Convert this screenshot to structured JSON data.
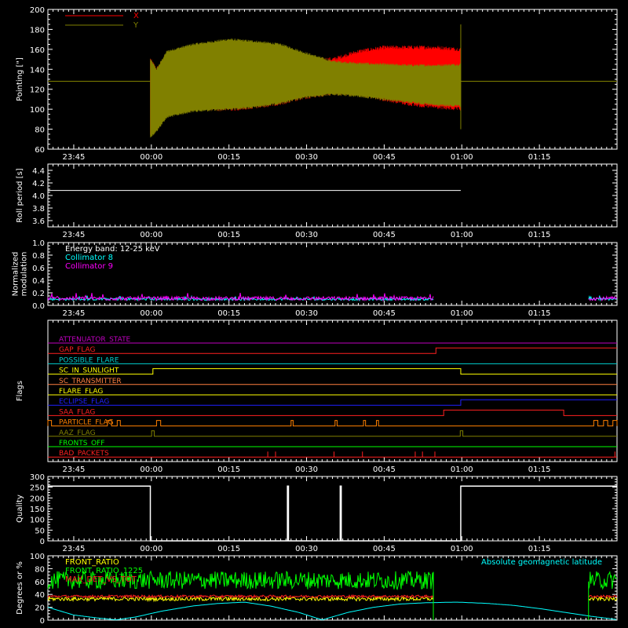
{
  "chart_data": [
    {
      "id": "pointing",
      "type": "line",
      "ylabel": "Pointing [\"]",
      "ylim": [
        60,
        200
      ],
      "yticks": [
        60,
        80,
        100,
        120,
        140,
        160,
        180,
        200
      ],
      "xlim_minutes": [
        -20,
        90
      ],
      "x_tick_minutes": [
        -15,
        0,
        15,
        30,
        45,
        60,
        75
      ],
      "xtick_labels": [
        "23:45",
        "00:00",
        "00:15",
        "00:30",
        "00:45",
        "01:00",
        "01:15"
      ],
      "legend": {
        "position": "top-left",
        "entries": [
          {
            "name": "X",
            "color": "#ff0000"
          },
          {
            "name": "Y",
            "color": "#808000"
          }
        ]
      },
      "baseline": 128,
      "x_envelope": {
        "minutes": [
          -0.2,
          1,
          3,
          8,
          15,
          20,
          25,
          30,
          35,
          40,
          45,
          50,
          55,
          59.8
        ],
        "upper": [
          150,
          140,
          155,
          162,
          166,
          165,
          160,
          150,
          150,
          158,
          162,
          162,
          162,
          160
        ],
        "lower": [
          75,
          80,
          95,
          100,
          100,
          102,
          106,
          112,
          116,
          115,
          110,
          105,
          102,
          100
        ]
      },
      "y_envelope": {
        "minutes": [
          -0.2,
          1,
          3,
          8,
          15,
          20,
          25,
          30,
          35,
          40,
          45,
          50,
          55,
          59.8
        ],
        "upper": [
          150,
          140,
          158,
          165,
          170,
          168,
          165,
          156,
          148,
          146,
          145,
          144,
          144,
          145
        ],
        "lower": [
          72,
          78,
          92,
          98,
          100,
          102,
          106,
          112,
          115,
          113,
          110,
          107,
          104,
          103
        ]
      },
      "spike": {
        "minute": 59.8,
        "min": 80,
        "max": 185
      }
    },
    {
      "id": "roll",
      "type": "line",
      "ylabel": "Roll period [s]",
      "ylim": [
        3.5,
        4.5
      ],
      "yticks": [
        3.6,
        3.8,
        4.0,
        4.2,
        4.4
      ],
      "yticks_labels": [
        "3.6",
        "3.8",
        "4.0",
        "4.2",
        "4.4"
      ],
      "xlim_minutes": [
        -20,
        90
      ],
      "x_tick_minutes": [
        -15,
        0,
        15,
        30,
        45,
        60,
        75
      ],
      "xtick_labels": [
        "23:45",
        "00:00",
        "00:15",
        "00:30",
        "00:45",
        "01:00",
        "01:15"
      ],
      "series": [
        {
          "color": "#ffffff",
          "x_minutes": [
            -20,
            59.8
          ],
          "values": [
            4.08,
            4.08
          ]
        }
      ]
    },
    {
      "id": "modulation",
      "type": "line",
      "ylabel": [
        "Normalized",
        "modulation"
      ],
      "ylim": [
        0,
        1.0
      ],
      "yticks": [
        0,
        0.2,
        0.4,
        0.6,
        0.8,
        1.0
      ],
      "yticks_labels": [
        "0.0",
        "0.2",
        "0.4",
        "0.6",
        "0.8",
        "1.0"
      ],
      "xlim_minutes": [
        -20,
        90
      ],
      "x_tick_minutes": [
        -15,
        0,
        15,
        30,
        45,
        60,
        75
      ],
      "xtick_labels": [
        "23:45",
        "00:00",
        "00:15",
        "00:30",
        "00:45",
        "01:00",
        "01:15"
      ],
      "annotations": [
        {
          "text": "Energy band: 12-25 keV",
          "color": "#ffffff"
        },
        {
          "text": "Collimator 8",
          "color": "#00ffff"
        },
        {
          "text": "Collimator 9",
          "color": "#ff00ff"
        }
      ],
      "series": [
        {
          "color": "#00ffff",
          "segments": [
            [
              -20,
              54.5
            ],
            [
              84.5,
              90
            ]
          ],
          "level": 0.1,
          "noise": 0.02
        },
        {
          "color": "#ff00ff",
          "segments": [
            [
              -20,
              54.5
            ],
            [
              84.5,
              90
            ]
          ],
          "level": 0.11,
          "noise": 0.03
        }
      ]
    },
    {
      "id": "flags",
      "type": "line",
      "ylabel": "Flags",
      "xlim_minutes": [
        -20,
        90
      ],
      "x_tick_minutes": [
        -15,
        0,
        15,
        30,
        45,
        60,
        75
      ],
      "xtick_labels": [
        "23:45",
        "00:00",
        "00:15",
        "00:30",
        "00:45",
        "01:00",
        "01:15"
      ],
      "flags": [
        {
          "name": "ATTENUATOR_STATE",
          "color": "#c000c0",
          "steps": []
        },
        {
          "name": "GAP_FLAG",
          "color": "#ff2020",
          "steps": [
            [
              55,
              1
            ]
          ]
        },
        {
          "name": "POSSIBLE_FLARE",
          "color": "#00d0d0",
          "steps": []
        },
        {
          "name": "SC_IN_SUNLIGHT",
          "color": "#ffff00",
          "steps": [
            [
              0.3,
              1
            ],
            [
              59.8,
              0
            ]
          ]
        },
        {
          "name": "SC_TRANSMITTER",
          "color": "#ff8040",
          "steps": []
        },
        {
          "name": "FLARE_FLAG",
          "color": "#ffff00",
          "steps": []
        },
        {
          "name": "ECLIPSE_FLAG",
          "color": "#2020ff",
          "steps": [
            [
              0.3,
              0
            ],
            [
              59.8,
              1
            ]
          ]
        },
        {
          "name": "SAA_FLAG",
          "color": "#ff2020",
          "steps": [
            [
              56.5,
              1
            ],
            [
              79.7,
              0
            ]
          ]
        },
        {
          "name": "PARTICLE_FLAG",
          "color": "#ff8000",
          "pulses": [
            [
              -8.5,
              -7.7
            ],
            [
              -6.6,
              -6
            ],
            [
              1.0,
              1.8
            ],
            [
              27,
              27.4
            ],
            [
              35.5,
              35.9
            ],
            [
              41,
              41.4
            ],
            [
              43.5,
              43.9
            ],
            [
              85.5,
              86.3
            ],
            [
              87.4,
              88.2
            ],
            [
              89.2,
              90
            ]
          ],
          "base_on": [
            [
              -20,
              -19.3
            ]
          ]
        },
        {
          "name": "AAZ_FLAG",
          "color": "#808000",
          "pulses": [
            [
              0.05,
              0.55
            ],
            [
              59.7,
              60.2
            ]
          ]
        },
        {
          "name": "FRONTS_OFF",
          "color": "#00ff00",
          "steps": []
        },
        {
          "name": "BAD_PACKETS",
          "color": "#ff2020",
          "ticks": [
            22.5,
            24,
            35.3,
            40.8,
            51,
            52.4,
            54.8,
            89.6
          ]
        }
      ]
    },
    {
      "id": "quality",
      "type": "line",
      "ylabel": "Quality",
      "ylim": [
        0,
        300
      ],
      "yticks": [
        0,
        50,
        100,
        150,
        200,
        250,
        300
      ],
      "xlim_minutes": [
        -20,
        90
      ],
      "x_tick_minutes": [
        -15,
        0,
        15,
        30,
        45,
        60,
        75
      ],
      "xtick_labels": [
        "23:45",
        "00:00",
        "00:15",
        "00:30",
        "00:45",
        "01:00",
        "01:15"
      ],
      "series": [
        {
          "color": "#ffffff",
          "x_minutes": [
            -20,
            -0.2,
            -0.2,
            26.3,
            26.3,
            26.5,
            26.5,
            36.5,
            36.5,
            36.7,
            36.7,
            59.8,
            59.8,
            90
          ],
          "values": [
            255,
            255,
            0,
            0,
            255,
            255,
            0,
            0,
            255,
            255,
            0,
            0,
            255,
            255
          ]
        }
      ]
    },
    {
      "id": "ratios",
      "type": "line",
      "ylabel": "Degrees or %",
      "ylim": [
        0,
        100
      ],
      "yticks": [
        0,
        20,
        40,
        60,
        80,
        100
      ],
      "xlim_minutes": [
        -20,
        90
      ],
      "x_tick_minutes": [
        -15,
        0,
        15,
        30,
        45,
        60,
        75
      ],
      "legend": {
        "position": "top-left",
        "entries": [
          {
            "name": "FRONT_RATIO",
            "color": "#ffff00"
          },
          {
            "name": "FRONT_RATIO_1225",
            "color": "#00ff00"
          },
          {
            "name": "MAX_DET_VS_TOT",
            "color": "#ff2020"
          }
        ]
      },
      "right_label": {
        "text": "Absolute geomagnetic latitude",
        "color": "#00ffff"
      },
      "series": [
        {
          "name": "FRONT_RATIO",
          "color": "#ffff00",
          "segments": [
            [
              -20,
              54.5
            ],
            [
              84.5,
              90
            ]
          ],
          "level": 33,
          "noise": 3
        },
        {
          "name": "FRONT_RATIO_1225",
          "color": "#00ff00",
          "segments": [
            [
              -20,
              54.5
            ],
            [
              84.5,
              90
            ]
          ],
          "level": 62,
          "noise": 14
        },
        {
          "name": "MAX_DET_VS_TOT",
          "color": "#ff2020",
          "segments": [
            [
              -20,
              54.5
            ],
            [
              84.5,
              90
            ]
          ],
          "level": 37,
          "noise": 2
        },
        {
          "name": "Absolute geomagnetic latitude",
          "color": "#00ffff",
          "x_minutes": [
            -20,
            -15,
            -10,
            -6.8,
            -3,
            2,
            8,
            13,
            18,
            23,
            28.5,
            33,
            38,
            43,
            48,
            53,
            59,
            65,
            70,
            75,
            80,
            85,
            90
          ],
          "values": [
            20,
            8,
            3,
            0.5,
            5,
            14,
            22,
            26,
            28,
            22,
            12,
            0.5,
            12,
            20,
            25,
            27,
            28,
            26,
            23,
            18,
            12,
            6,
            1
          ]
        }
      ]
    }
  ]
}
